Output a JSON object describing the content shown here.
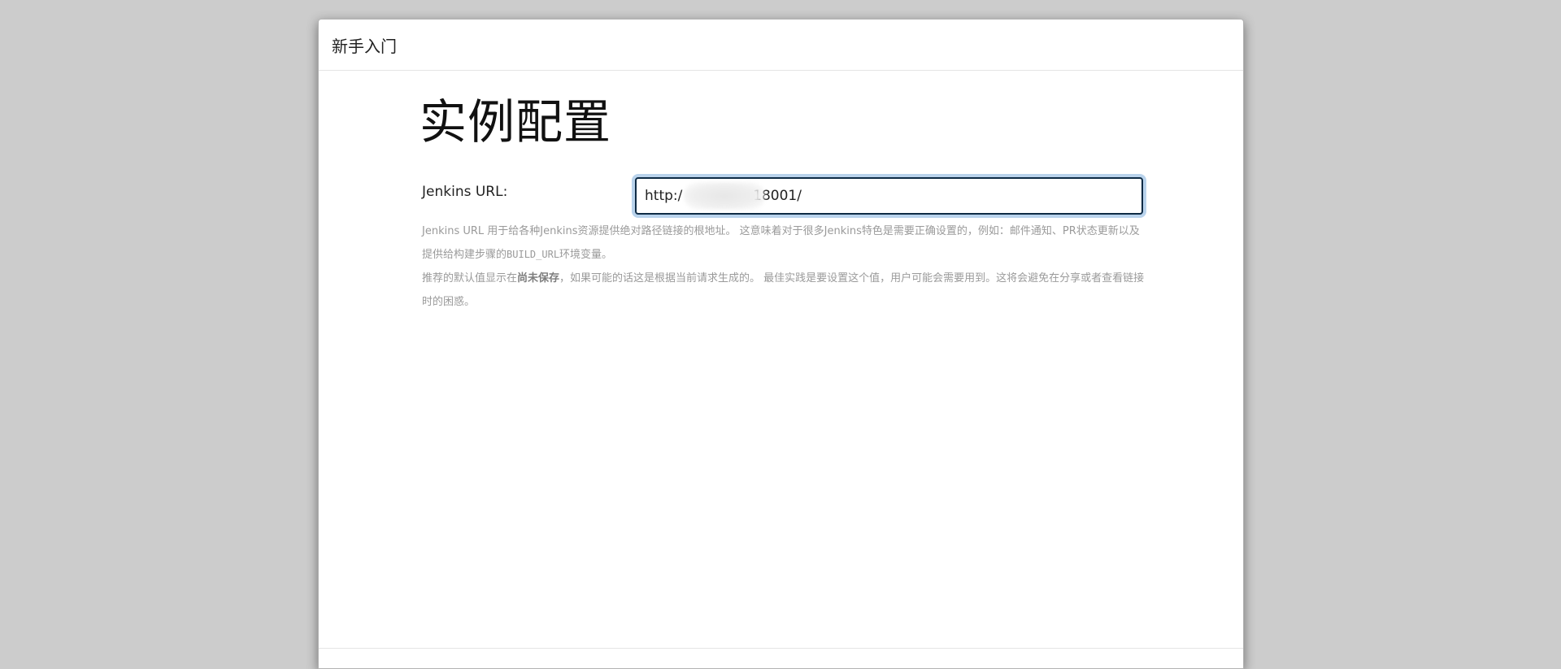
{
  "dialog": {
    "title": "新手入门"
  },
  "page": {
    "heading": "实例配置"
  },
  "jenkins_url": {
    "label": "Jenkins URL:",
    "value": "http:/               :18001/"
  },
  "help": {
    "p1_part1": "Jenkins URL 用于给各种Jenkins资源提供绝对路径链接的根地址。 这意味着对于很多Jenkins特色是需要正确设置的，例如：邮件通知、PR状态更新以及提供给构建步骤的",
    "p1_code": "BUILD_URL",
    "p1_part2": "环境变量。",
    "p2_part1": "推荐的默认值显示在",
    "p2_bold": "尚未保存",
    "p2_part2": "，如果可能的话这是根据当前请求生成的。 最佳实践是要设置这个值，用户可能会需要用到。这将会避免在分享或者查看链接时的困惑。"
  }
}
